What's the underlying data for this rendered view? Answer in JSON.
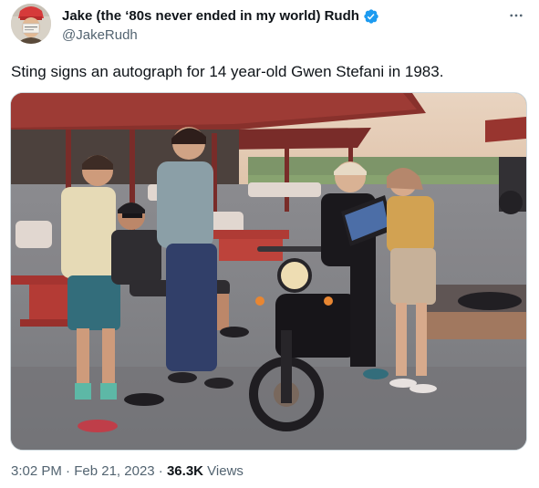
{
  "author": {
    "display_name": "Jake (the ‘80s never ended in my world) Rudh",
    "handle": "@JakeRudh",
    "verified": true,
    "verified_color": "#1d9bf0"
  },
  "menu_icon": "more-horizontal-icon",
  "tweet": {
    "text": "Sting signs an autograph for 14 year-old Gwen Stefani in 1983."
  },
  "media": {
    "type": "photo",
    "alt": ""
  },
  "meta": {
    "time": "3:02 PM",
    "separator1": "·",
    "date": "Feb 21, 2023",
    "separator2": "·",
    "views_count": "36.3K",
    "views_label": "Views"
  },
  "colors": {
    "text_primary": "#0f1419",
    "text_secondary": "#536471",
    "border": "#cfd9de"
  }
}
